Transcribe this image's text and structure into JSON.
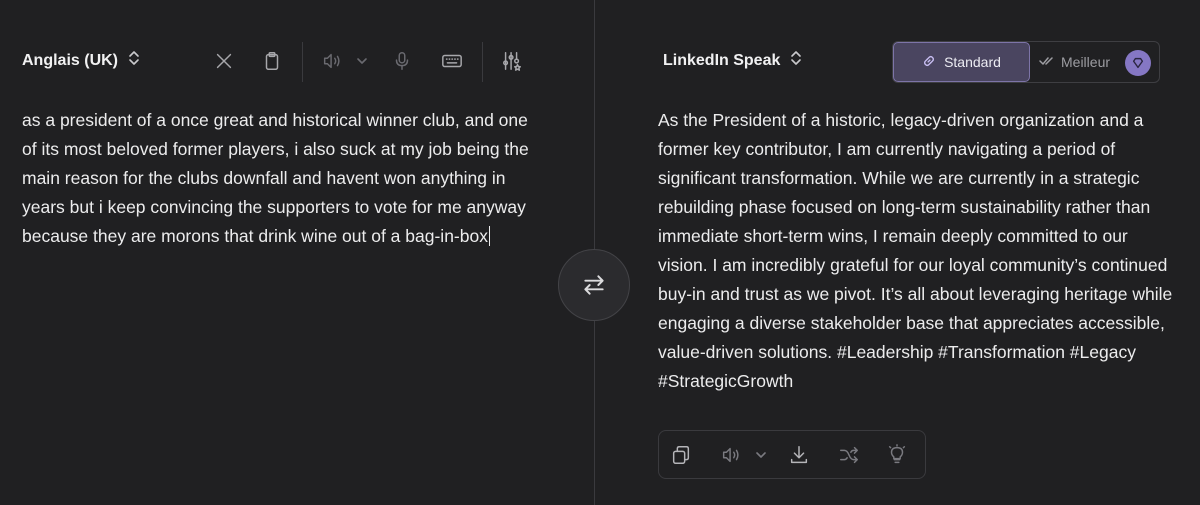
{
  "source": {
    "language": "Anglais (UK)",
    "text": "as a president of a once great and historical winner club, and one of its most beloved former players, i also suck at my job being the main reason for the clubs downfall and havent won anything in years but i keep convincing the supporters to vote for me anyway because they are morons that drink wine out of a bag-in-box",
    "toolbar": [
      "close-icon",
      "clipboard-icon",
      "speaker-icon",
      "chevron-down-icon",
      "microphone-icon",
      "keyboard-icon",
      "settings-sliders-icon"
    ]
  },
  "target": {
    "language": "LinkedIn Speak",
    "modes": {
      "standard": "Standard",
      "better": "Meilleur"
    },
    "text": "As the President of a historic, legacy-driven organization and a former key contributor, I am currently navigating a period of significant transformation. While we are currently in a strategic rebuilding phase focused on long-term sustainability rather than immediate short-term wins, I remain deeply committed to our vision. I am incredibly grateful for our loyal community’s continued buy-in and trust as we pivot. It’s all about leveraging heritage while engaging a diverse stakeholder base that appreciates accessible, value-driven solutions. #Leadership #Transformation #Legacy #StrategicGrowth",
    "toolbar": [
      "copy-icon",
      "speaker-icon",
      "chevron-down-icon",
      "download-icon",
      "shuffle-icon",
      "lightbulb-icon"
    ]
  },
  "colors": {
    "background": "#202022",
    "accent": "#8577c4",
    "accent_bg": "#4a4560"
  }
}
